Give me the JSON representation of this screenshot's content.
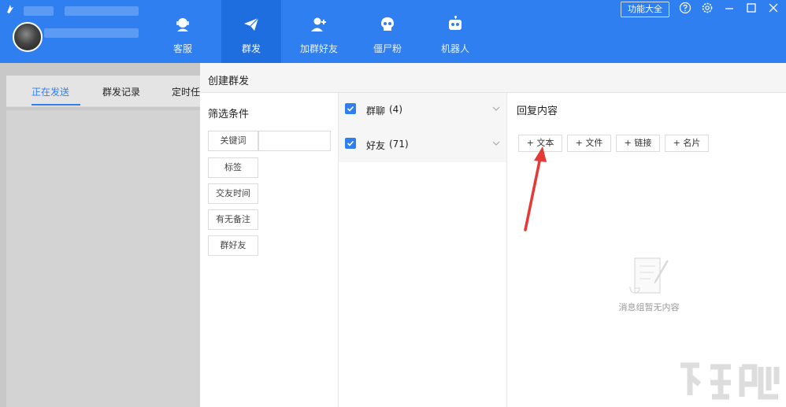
{
  "nav": {
    "items": [
      {
        "label": "客服"
      },
      {
        "label": "群发"
      },
      {
        "label": "加群好友"
      },
      {
        "label": "僵尸粉"
      },
      {
        "label": "机器人"
      }
    ],
    "active": "群发"
  },
  "window": {
    "function_button": "功能大全"
  },
  "tabs": [
    {
      "label": "正在发送"
    },
    {
      "label": "群发记录"
    },
    {
      "label": "定时任"
    }
  ],
  "dialog": {
    "title": "创建群发",
    "filter": {
      "title": "筛选条件",
      "buttons": [
        "关键词",
        "标签",
        "交友时间",
        "有无备注",
        "群好友"
      ]
    },
    "targets": [
      {
        "label": "群聊",
        "count": "(4)",
        "checked": true
      },
      {
        "label": "好友",
        "count": "(71)",
        "checked": true
      }
    ],
    "reply": {
      "title": "回复内容",
      "add_buttons": [
        "+ 文本",
        "+ 文件",
        "+ 链接",
        "+ 名片"
      ],
      "empty_text": "消息组暂无内容"
    }
  },
  "colors": {
    "accent": "#2f7ff0",
    "arrow": "#e53935"
  },
  "icons": [
    "headset-icon",
    "send-icon",
    "add-user-icon",
    "skull-icon",
    "robot-icon",
    "help-icon",
    "settings-icon",
    "minimize-icon",
    "maximize-icon",
    "close-icon"
  ]
}
